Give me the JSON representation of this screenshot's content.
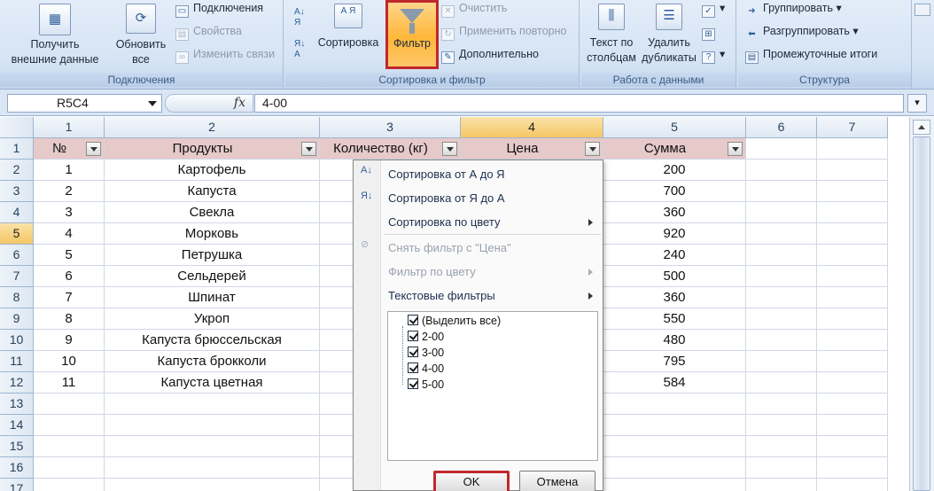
{
  "ribbon": {
    "get_external": "Получить\nвнешние данные",
    "refresh_all": "Обновить\nвсе",
    "connections": "Подключения",
    "properties": "Свойства",
    "edit_links": "Изменить связи",
    "group_connections": "Подключения",
    "sort_az": "А Я",
    "sort": "Сортировка",
    "filter": "Фильтр",
    "clear": "Очистить",
    "reapply": "Применить повторно",
    "advanced": "Дополнительно",
    "group_sort_filter": "Сортировка и фильтр",
    "text_to_columns": "Текст по\nстолбцам",
    "remove_duplicates": "Удалить\nдубликаты",
    "group_data_tools": "Работа с данными",
    "group_outline_btn": "Группировать",
    "ungroup": "Разгруппировать",
    "subtotal": "Промежуточные итоги",
    "group_outline": "Структура"
  },
  "formula_bar": {
    "name_box": "R5C4",
    "fx": "fx",
    "value": "4-00"
  },
  "columns": [
    "1",
    "2",
    "3",
    "4",
    "5",
    "6",
    "7"
  ],
  "rows": [
    "1",
    "2",
    "3",
    "4",
    "5",
    "6",
    "7",
    "8",
    "9",
    "10",
    "11",
    "12",
    "13",
    "14",
    "15",
    "16",
    "17"
  ],
  "table": {
    "headers": [
      "№",
      "Продукты",
      "Количество (кг)",
      "Цена",
      "Сумма"
    ],
    "data": [
      [
        "1",
        "Картофель",
        "200"
      ],
      [
        "2",
        "Капуста",
        "700"
      ],
      [
        "3",
        "Свекла",
        "360"
      ],
      [
        "4",
        "Морковь",
        "920"
      ],
      [
        "5",
        "Петрушка",
        "240"
      ],
      [
        "6",
        "Сельдерей",
        "500"
      ],
      [
        "7",
        "Шпинат",
        "360"
      ],
      [
        "8",
        "Укроп",
        "550"
      ],
      [
        "9",
        "Капуста брюссельская",
        "480"
      ],
      [
        "10",
        "Капуста брокколи",
        "795"
      ],
      [
        "11",
        "Капуста цветная",
        "584"
      ]
    ]
  },
  "filter_menu": {
    "sort_asc": "Сортировка от А до Я",
    "sort_desc": "Сортировка от Я до А",
    "sort_color": "Сортировка по цвету",
    "clear_filter": "Снять фильтр с \"Цена\"",
    "filter_color": "Фильтр по цвету",
    "text_filters": "Текстовые фильтры",
    "list": [
      "(Выделить все)",
      "2-00",
      "3-00",
      "4-00",
      "5-00"
    ],
    "ok": "OK",
    "cancel": "Отмена"
  },
  "colors": {
    "header_fill": "#e6c9c9",
    "highlight_border": "#c0282c",
    "selected_header": "#f5c665"
  }
}
